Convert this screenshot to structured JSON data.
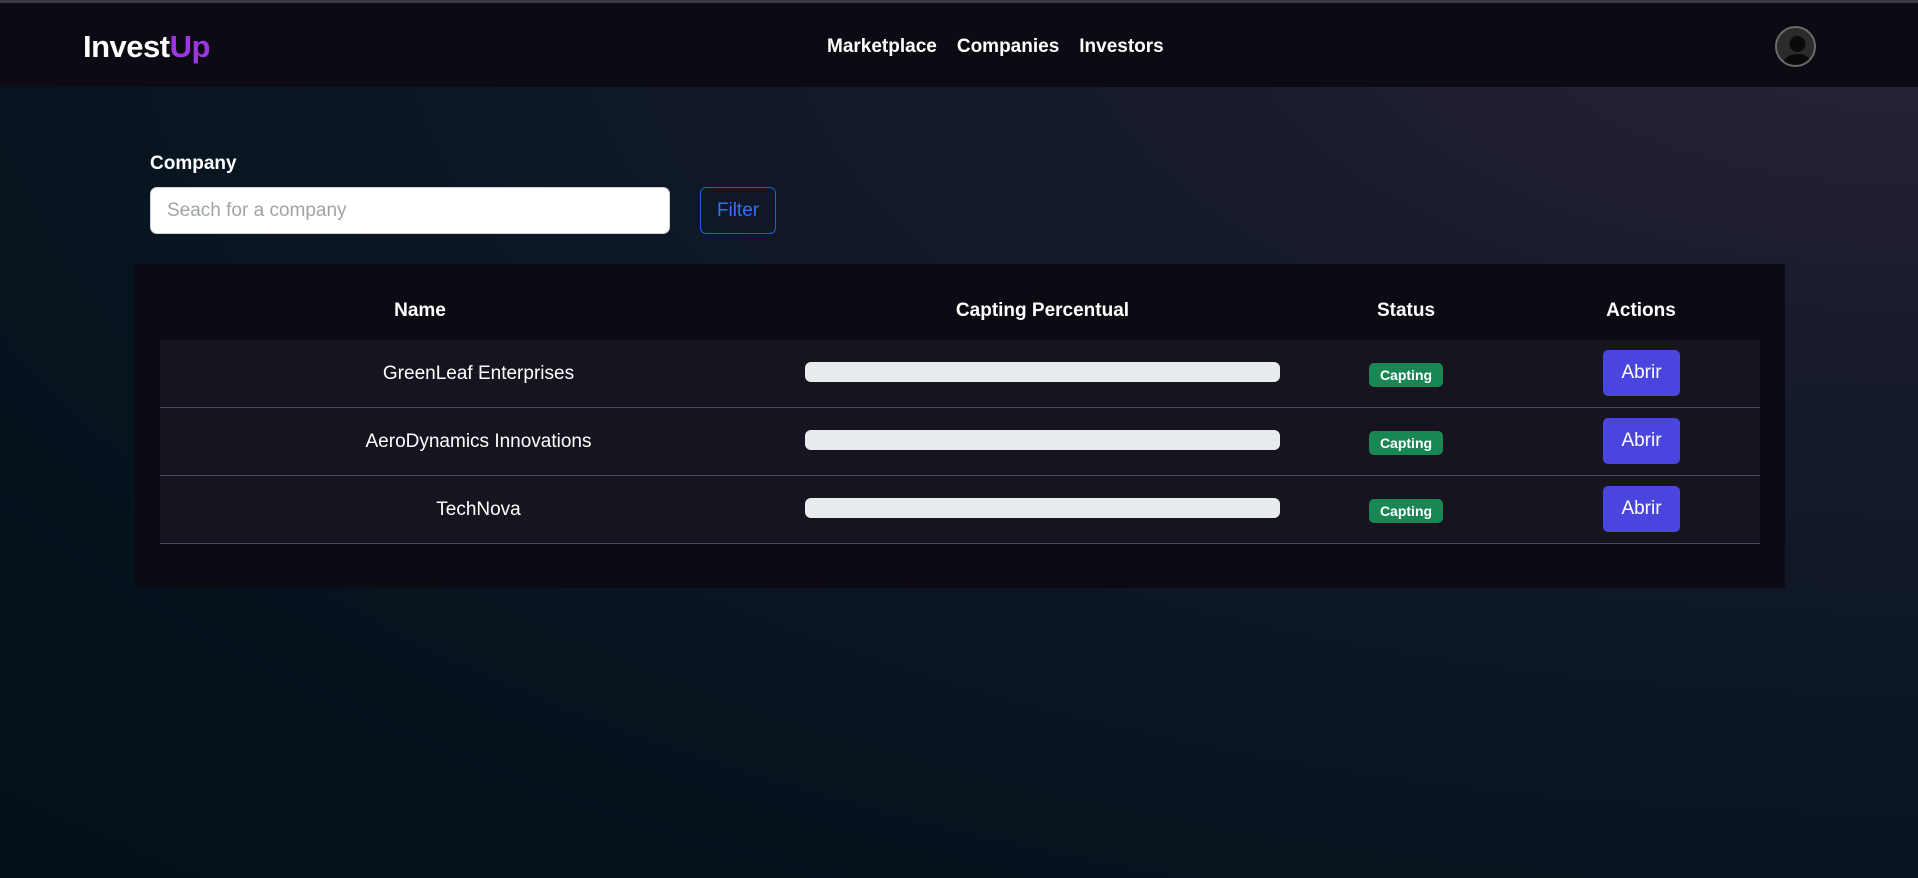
{
  "navbar": {
    "brand_part1": "Invest",
    "brand_part2": "Up",
    "links": [
      "Marketplace",
      "Companies",
      "Investors"
    ],
    "avatar_icon": "user-avatar-icon"
  },
  "filter": {
    "label": "Company",
    "placeholder": "Seach for a company",
    "value": "",
    "button_label": "Filter"
  },
  "table": {
    "headers": [
      "Name",
      "Capting Percentual",
      "Status",
      "Actions"
    ],
    "rows": [
      {
        "name": "GreenLeaf Enterprises",
        "progress_percent": 0,
        "status": "Capting",
        "action": "Abrir"
      },
      {
        "name": "AeroDynamics Innovations",
        "progress_percent": 0,
        "status": "Capting",
        "action": "Abrir"
      },
      {
        "name": "TechNova",
        "progress_percent": 0,
        "status": "Capting",
        "action": "Abrir"
      }
    ]
  },
  "colors": {
    "brand_accent": "#9b36e0",
    "status_badge": "#198754",
    "action_button": "#4b45e0",
    "filter_button": "#2f73f2"
  }
}
